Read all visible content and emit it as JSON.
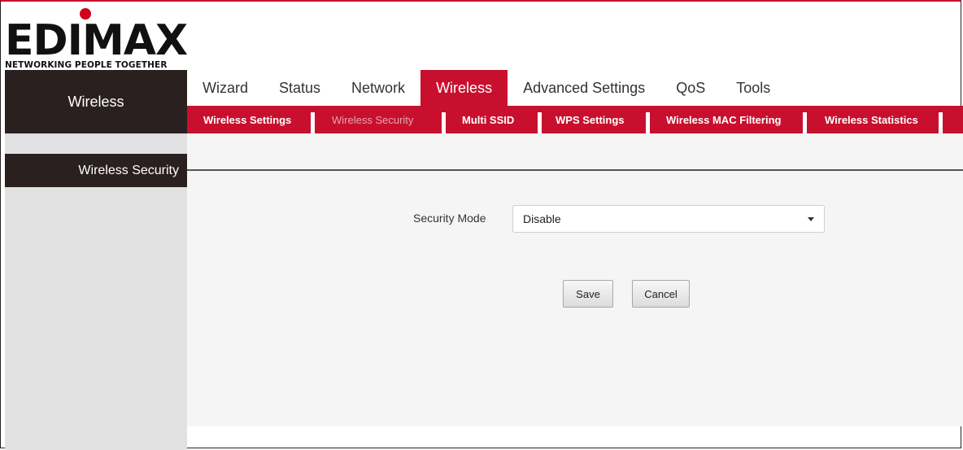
{
  "brand": {
    "logo_text": "EDIMAX",
    "tagline": "NETWORKING PEOPLE TOGETHER",
    "accent_color": "#c8102e"
  },
  "sidebar": {
    "section_title": "Wireless",
    "items": [
      {
        "label": "Wireless Security",
        "active": true
      }
    ]
  },
  "topnav": {
    "tabs": [
      {
        "label": "Wizard",
        "active": false
      },
      {
        "label": "Status",
        "active": false
      },
      {
        "label": "Network",
        "active": false
      },
      {
        "label": "Wireless",
        "active": true
      },
      {
        "label": "Advanced Settings",
        "active": false
      },
      {
        "label": "QoS",
        "active": false
      },
      {
        "label": "Tools",
        "active": false
      }
    ]
  },
  "subnav": {
    "tabs": [
      {
        "label": "Wireless Settings",
        "active": false
      },
      {
        "label": "Wireless Security",
        "active": true
      },
      {
        "label": "Multi SSID",
        "active": false
      },
      {
        "label": "WPS Settings",
        "active": false
      },
      {
        "label": "Wireless MAC Filtering",
        "active": false
      },
      {
        "label": "Wireless Statistics",
        "active": false
      }
    ]
  },
  "form": {
    "security_mode_label": "Security Mode",
    "security_mode_value": "Disable",
    "save_label": "Save",
    "cancel_label": "Cancel"
  }
}
